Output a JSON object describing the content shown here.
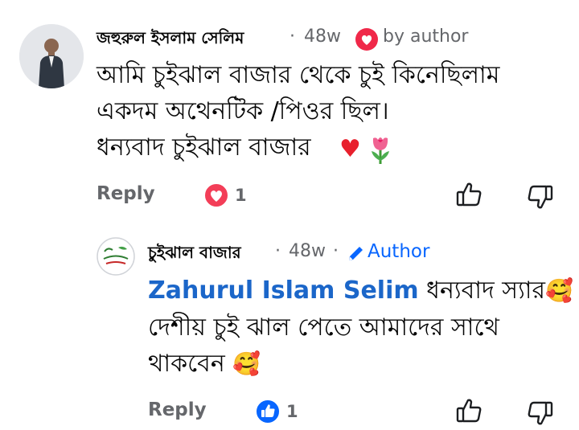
{
  "comment": {
    "author_name": "জহুরুল ইসলাম সেলিম",
    "sep": "·",
    "time": "48w",
    "badge_label": "by author",
    "lines": [
      "আমি চুইঝাল বাজার থেকে চুই কিনেছিলাম",
      "একদম অথেনটিক /পিওর ছিল।",
      "ধন্যবাদ চুইঝাল বাজার"
    ],
    "emojis": [
      "♥",
      "🌷"
    ],
    "reply_label": "Reply",
    "reaction_count": "1",
    "reaction_icon": "love-reaction-icon",
    "accent_love": "#f33e58"
  },
  "reply": {
    "author_name": "চুইঝাল বাজার",
    "avatar_logo_text": "চুইঝাল বাজার",
    "sep": "·",
    "time": "48w",
    "sep2": "·",
    "author_label": "Author",
    "mention": "Zahurul Islam Selim",
    "line1_text": "ধন্যবাদ স্যার",
    "line2": "দেশীয় চুই ঝাল পেতে আমাদের সাথে",
    "line3": "থাকবেন",
    "emoji": "🥰",
    "reply_label": "Reply",
    "reaction_count": "1",
    "reaction_icon": "like-reaction-icon",
    "accent_like": "#0866ff"
  }
}
